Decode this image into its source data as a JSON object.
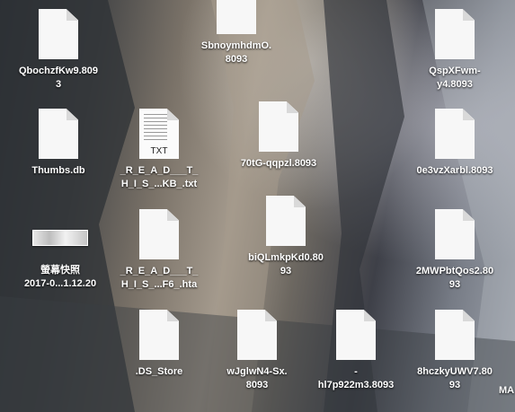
{
  "desktop": {
    "icons": [
      {
        "name_lines": [
          "QbochzfKw9.809",
          "3"
        ]
      },
      {
        "name_lines": [
          "SbnoymhdmO.",
          "8093"
        ]
      },
      {
        "name_lines": [
          "QspXFwm-",
          "y4.8093"
        ]
      },
      {
        "name_lines": [
          "Thumbs.db"
        ]
      },
      {
        "name_lines": [
          "_R_E_A_D___T_",
          "H_I_S_...KB_.txt"
        ],
        "type_label": "TXT"
      },
      {
        "name_lines": [
          "70tG-qqpzl.8093"
        ]
      },
      {
        "name_lines": [
          "0e3vzXarbl.8093"
        ]
      },
      {
        "name_lines": [
          "螢幕快照",
          "2017-0...1.12.20"
        ]
      },
      {
        "name_lines": [
          "_R_E_A_D___T_",
          "H_I_S_...F6_.hta"
        ]
      },
      {
        "name_lines": [
          "biQLmkpKd0.80",
          "93"
        ]
      },
      {
        "name_lines": [
          "2MWPbtQos2.80",
          "93"
        ]
      },
      {
        "name_lines": [
          ".DS_Store"
        ]
      },
      {
        "name_lines": [
          "wJglwN4-Sx.",
          "8093"
        ]
      },
      {
        "name_lines": [
          "-",
          "hl7p922m3.8093"
        ]
      },
      {
        "name_lines": [
          "8hczkyUWV7.80",
          "93"
        ]
      },
      {
        "name_lines": [
          "MA"
        ]
      }
    ]
  },
  "colors": {
    "label_text": "#ffffff",
    "document_fill": "#f7f7f7"
  }
}
